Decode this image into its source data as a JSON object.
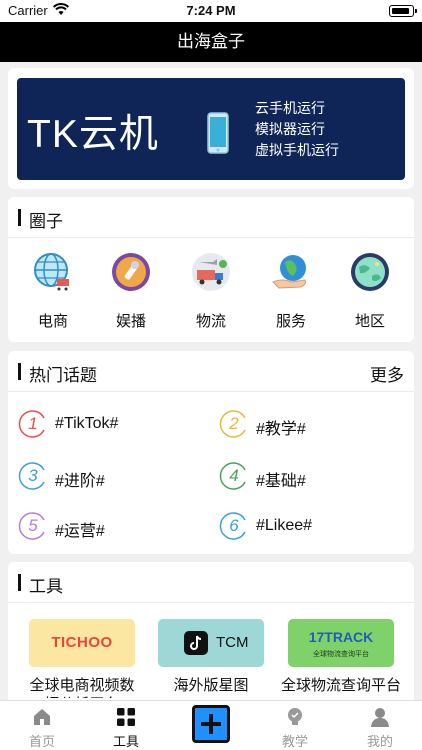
{
  "status_bar": {
    "carrier": "Carrier",
    "time": "7:24 PM"
  },
  "navbar": {
    "title": "出海盒子"
  },
  "banner": {
    "title": "TK云机",
    "lines": [
      "云手机运行",
      "模拟器运行",
      "虚拟手机运行"
    ],
    "bg_color": "#0f2557"
  },
  "circles": {
    "title": "圈子",
    "items": [
      {
        "label": "电商",
        "icon": "globe-cart-icon"
      },
      {
        "label": "娱播",
        "icon": "microphone-icon"
      },
      {
        "label": "物流",
        "icon": "truck-icon"
      },
      {
        "label": "服务",
        "icon": "hand-globe-icon"
      },
      {
        "label": "地区",
        "icon": "planet-icon"
      }
    ]
  },
  "hot_topics": {
    "title": "热门话题",
    "more": "更多",
    "items": [
      {
        "num": "1",
        "label": "#TikTok#",
        "color": "#e8504b"
      },
      {
        "num": "2",
        "label": "#教学#",
        "color": "#e8b73b"
      },
      {
        "num": "3",
        "label": "#进阶#",
        "color": "#3aa0d8"
      },
      {
        "num": "4",
        "label": "#基础#",
        "color": "#4aa35a"
      },
      {
        "num": "5",
        "label": "#运营#",
        "color": "#b77ed6"
      },
      {
        "num": "6",
        "label": "#Likee#",
        "color": "#3aa0d8"
      }
    ]
  },
  "tools": {
    "title": "工具",
    "items": [
      {
        "logo_text": "TICHOO",
        "name": "全球电商视频数据分析平台",
        "bg": "#fbe7a1"
      },
      {
        "logo_text": "TCM",
        "name": "海外版星图",
        "bg": "#9ed8d6"
      },
      {
        "logo_text": "17TRACK",
        "logo_sub": "全球物流查询平台",
        "name": "全球物流查询平台",
        "bg": "#7fd26a"
      }
    ]
  },
  "tabbar": {
    "items": [
      {
        "label": "首页",
        "icon": "home-icon"
      },
      {
        "label": "工具",
        "icon": "grid-icon"
      },
      {
        "label": "教学",
        "icon": "lightbulb-icon"
      },
      {
        "label": "我的",
        "icon": "user-icon"
      }
    ],
    "plus_icon": "plus-icon"
  }
}
